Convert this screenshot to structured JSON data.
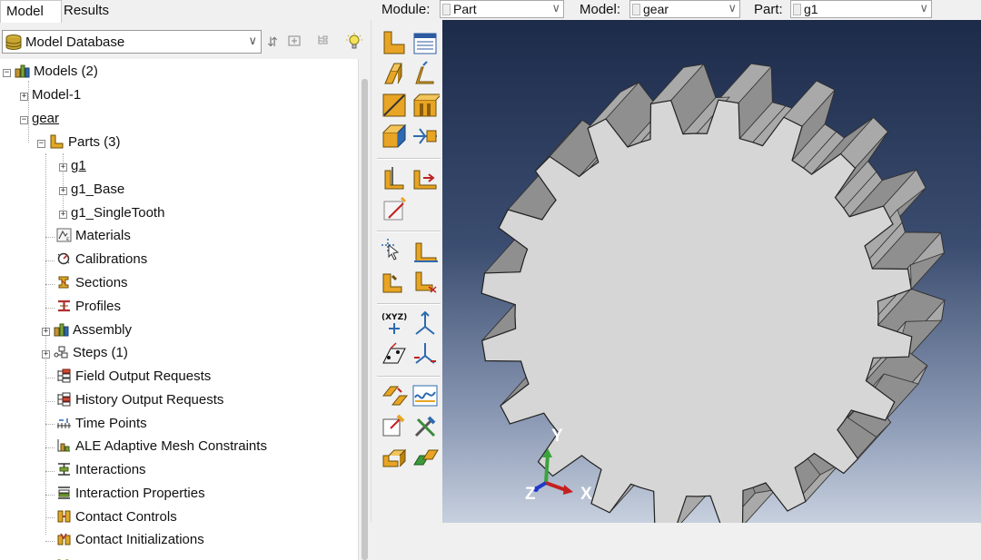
{
  "tabs": {
    "model": "Model",
    "results": "Results"
  },
  "module_bar": {
    "module_label": "Module:",
    "module_value": "Part",
    "model_label": "Model:",
    "model_value": "gear",
    "part_label": "Part:",
    "part_value": "g1"
  },
  "database": {
    "label": "Model Database"
  },
  "tree": {
    "models": "Models (2)",
    "model1": "Model-1",
    "gear": "gear",
    "parts": "Parts (3)",
    "g1": "g1",
    "g1_base": "g1_Base",
    "g1_singletooth": "g1_SingleTooth",
    "materials": "Materials",
    "calibrations": "Calibrations",
    "sections": "Sections",
    "profiles": "Profiles",
    "assembly": "Assembly",
    "steps": "Steps (1)",
    "field_output": "Field Output Requests",
    "history_output": "History Output Requests",
    "time_points": "Time Points",
    "ale": "ALE Adaptive Mesh Constraints",
    "interactions": "Interactions",
    "interaction_props": "Interaction Properties",
    "contact_controls": "Contact Controls",
    "contact_inits": "Contact Initializations"
  },
  "triad": {
    "x": "X",
    "y": "Y",
    "z": "Z"
  },
  "toolbox_icons": [
    "create-part-icon",
    "part-manager-icon",
    "create-solid-extrude-icon",
    "create-shell-icon",
    "create-wire-icon",
    "create-cut-icon",
    "create-round-icon",
    "create-datum-icon",
    "partition-face-icon",
    "partition-cell-icon",
    "virtual-topology-icon",
    "query-icon",
    "assign-icon",
    "repair-icon",
    "section-sketch-icon",
    "create-datum-point-icon",
    "create-datum-axis-icon",
    "create-datum-plane-icon",
    "datum-csys-icon",
    "geometry-edit-icon",
    "feature-manager-icon",
    "set-manager-icon",
    "tools-icon",
    "replace-part-icon",
    "copy-part-icon"
  ],
  "colors": {
    "gear_face": "#d6d6d6",
    "gear_side": "#a9a9a9",
    "viewport_top": "#1d2b4a",
    "viewport_bottom": "#c7d0de"
  }
}
